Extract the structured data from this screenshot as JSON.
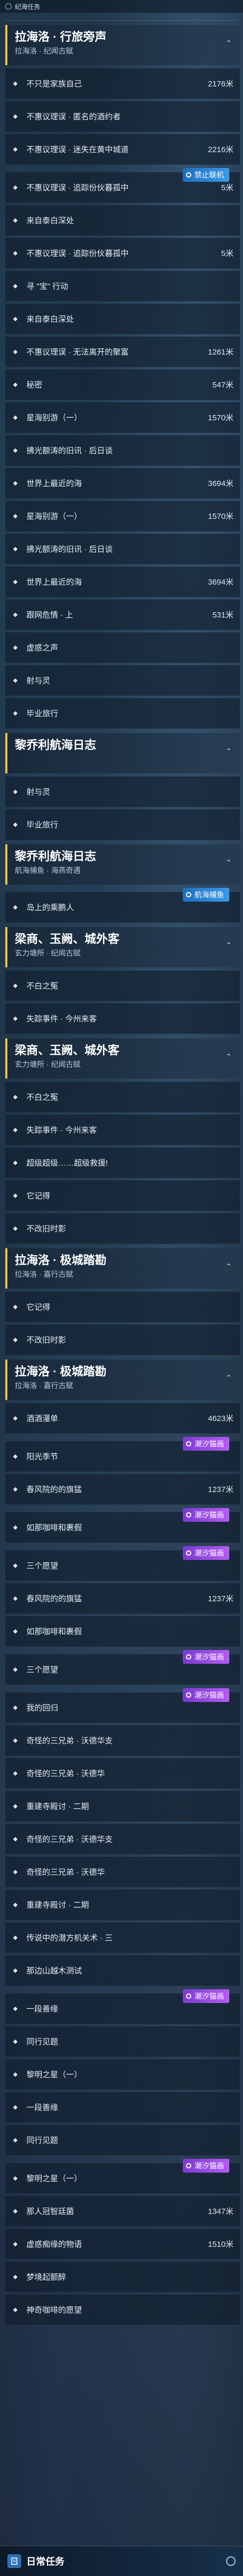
{
  "topbar": {
    "title": "纪海任务"
  },
  "colors": {
    "accent": "#f4c542",
    "tag_purple": "#9b4de6",
    "tag_blue": "#2a86d6"
  },
  "sections": [
    {
      "title": "拉海洛 · 行旅旁声",
      "subtitle": "拉海洛 · 纪闻古赋",
      "items": [
        {
          "label": "不只是家族自己",
          "dist": "2176米",
          "icon": "diamond"
        },
        {
          "label": "不惠议理误 · 匿名的酒约者",
          "dist": "",
          "icon": "diamond"
        },
        {
          "label": "不惠议理误 · 迷失在黄中城道",
          "dist": "2216米",
          "icon": "diamond"
        },
        {
          "label": "不惠议理误 · 追踪份伙暮孤中",
          "dist": "5米",
          "icon": "diamond",
          "tag": "禁止联机",
          "tag_color": "blue"
        },
        {
          "label": "来自泰白深处",
          "dist": "",
          "icon": "diamond"
        },
        {
          "label": "不惠议理误 · 追踪份伙暮孤中",
          "dist": "5米",
          "icon": "diamond"
        },
        {
          "label": "寻 \"宝\" 行动",
          "dist": "",
          "icon": "diamond"
        },
        {
          "label": "来自泰白深处",
          "dist": "",
          "icon": "diamond"
        },
        {
          "label": "不惠议理误 · 无法离开的聚富",
          "dist": "1261米",
          "icon": "diamond"
        },
        {
          "label": "秘密",
          "dist": "547米",
          "icon": "diamond"
        },
        {
          "label": "星海别游（一）",
          "dist": "1570米",
          "icon": "diamond"
        },
        {
          "label": "拂光额涛的旧讯 · 后日谈",
          "dist": "",
          "icon": "diamond"
        },
        {
          "label": "世界上最近的海",
          "dist": "3694米",
          "icon": "diamond"
        },
        {
          "label": "星海别游（一）",
          "dist": "1570米",
          "icon": "diamond"
        },
        {
          "label": "拂光额涛的旧讯 · 后日谈",
          "dist": "",
          "icon": "diamond"
        },
        {
          "label": "世界上最近的海",
          "dist": "3694米",
          "icon": "diamond"
        },
        {
          "label": "跟网危情 · 上",
          "dist": "531米",
          "icon": "diamond"
        },
        {
          "label": "虚惑之声",
          "dist": "",
          "icon": "diamond"
        },
        {
          "label": "射与灵",
          "dist": "",
          "icon": "diamond"
        },
        {
          "label": "毕业旅行",
          "dist": "",
          "icon": "diamond"
        }
      ]
    },
    {
      "title": "黎乔利航海日志",
      "subtitle": "",
      "items": [
        {
          "label": "射与灵",
          "dist": "",
          "icon": "diamond"
        },
        {
          "label": "毕业旅行",
          "dist": "",
          "icon": "diamond"
        }
      ]
    },
    {
      "title": "黎乔利航海日志",
      "subtitle": "航海捕鱼 · 海燕奇遇",
      "items": [
        {
          "label": "岛上的乘鹏人",
          "dist": "",
          "icon": "diamond",
          "tag": "航海捕鱼",
          "tag_color": "blue"
        }
      ]
    },
    {
      "title": "梁商、玉阙、城外客",
      "subtitle": "玄力塘所 · 纪闻古赋",
      "items": [
        {
          "label": "不白之冤",
          "dist": "",
          "icon": "diamond"
        },
        {
          "label": "失踪事件 · 今州来客",
          "dist": "",
          "icon": "diamond"
        }
      ]
    },
    {
      "title": "梁商、玉阙、城外客",
      "subtitle": "玄力塘所 · 纪闻古赋",
      "items": [
        {
          "label": "不白之冤",
          "dist": "",
          "icon": "diamond"
        },
        {
          "label": "失踪事件 · 今州来客",
          "dist": "",
          "icon": "diamond"
        },
        {
          "label": "超级超级……超级救援!",
          "dist": "",
          "icon": "diamond"
        },
        {
          "label": "它记得",
          "dist": "",
          "icon": "diamond"
        },
        {
          "label": "不改旧时影",
          "dist": "",
          "icon": "diamond"
        }
      ]
    },
    {
      "title": "拉海洛 · 极城踏勘",
      "subtitle": "拉海洛 · 嘉行古赋",
      "items": [
        {
          "label": "它记得",
          "dist": "",
          "icon": "diamond"
        },
        {
          "label": "不改旧时影",
          "dist": "",
          "icon": "diamond"
        }
      ]
    },
    {
      "title": "拉海洛 · 极城踏勘",
      "subtitle": "拉海洛 · 嘉行古赋",
      "items": [
        {
          "label": "酒酒漫单",
          "dist": "4623米",
          "icon": "diamond"
        },
        {
          "label": "阳光季节",
          "dist": "",
          "icon": "diamond",
          "tag": "潮汐猫画",
          "tag_color": "purple"
        },
        {
          "label": "春风院的的旗猛",
          "dist": "1237米",
          "icon": "diamond"
        },
        {
          "label": "如那咖啡和裹假",
          "dist": "",
          "icon": "diamond",
          "tag": "潮汐猫画",
          "tag_color": "purple"
        },
        {
          "label": "三个愿望",
          "dist": "",
          "icon": "diamond",
          "tag": "潮汐猫画",
          "tag_color": "purple"
        },
        {
          "label": "春风院的的旗猛",
          "dist": "1237米",
          "icon": "diamond"
        },
        {
          "label": "如那咖啡和裹假",
          "dist": "",
          "icon": "diamond"
        },
        {
          "label": "三个愿望",
          "dist": "",
          "icon": "diamond",
          "tag": "潮汐猫画",
          "tag_color": "purple"
        },
        {
          "label": "我的回归",
          "dist": "",
          "icon": "diamond",
          "tag": "潮汐猫画",
          "tag_color": "purple"
        },
        {
          "label": "奇怪的三兄弟 · 沃德华支",
          "dist": "",
          "icon": "diamond"
        },
        {
          "label": "奇怪的三兄弟 · 沃德华",
          "dist": "",
          "icon": "diamond"
        },
        {
          "label": "重建寺殿讨 · 二期",
          "dist": "",
          "icon": "diamond"
        },
        {
          "label": "奇怪的三兄弟 · 沃德华支",
          "dist": "",
          "icon": "diamond"
        },
        {
          "label": "奇怪的三兄弟 · 沃德华",
          "dist": "",
          "icon": "diamond"
        },
        {
          "label": "重建寺殿讨 · 二期",
          "dist": "",
          "icon": "diamond"
        },
        {
          "label": "传说中的潜方机关术 · 三",
          "dist": "",
          "icon": "diamond"
        },
        {
          "label": "那边山越木测试",
          "dist": "",
          "icon": "diamond"
        },
        {
          "label": "一段善缘",
          "dist": "",
          "icon": "diamond",
          "tag": "潮汐猫画",
          "tag_color": "purple"
        },
        {
          "label": "同行见题",
          "dist": "",
          "icon": "diamond"
        },
        {
          "label": "黎明之星（一）",
          "dist": "",
          "icon": "diamond"
        },
        {
          "label": "一段善缘",
          "dist": "",
          "icon": "diamond"
        },
        {
          "label": "同行见题",
          "dist": "",
          "icon": "diamond"
        },
        {
          "label": "黎明之星（一）",
          "dist": "",
          "icon": "diamond",
          "tag": "潮汐猫画",
          "tag_color": "purple"
        },
        {
          "label": "那人冠智廷菌",
          "dist": "1347米",
          "icon": "diamond"
        },
        {
          "label": "虚惑痴缘的物语",
          "dist": "1510米",
          "icon": "diamond"
        },
        {
          "label": "梦境起颤醉",
          "dist": "",
          "icon": "diamond"
        },
        {
          "label": "神奇咖啡的愿望",
          "dist": "",
          "icon": "diamond"
        }
      ]
    }
  ],
  "footer": {
    "label": "日常任务"
  }
}
